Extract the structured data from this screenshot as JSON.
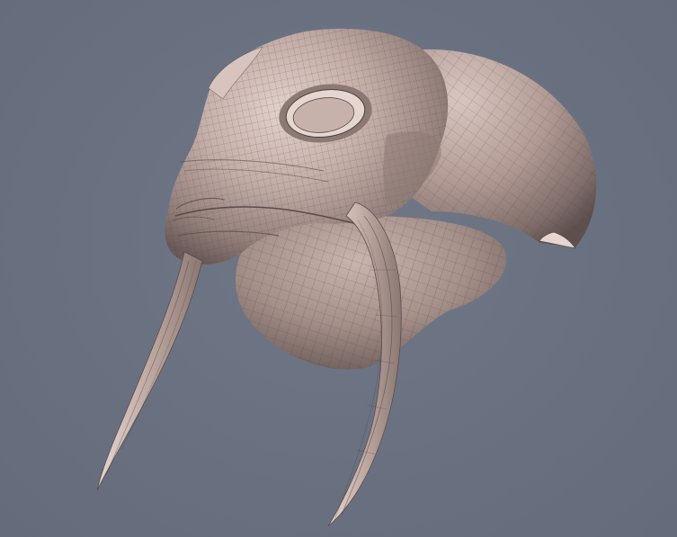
{
  "viewport": {
    "background": "#697181",
    "model": {
      "shading": "smooth-with-wireframe",
      "base_color": "#b9a29d",
      "shadow_color": "#6e5e5c",
      "highlight_color": "#e8d8d2",
      "wire_color": "#4a3e3c"
    }
  }
}
